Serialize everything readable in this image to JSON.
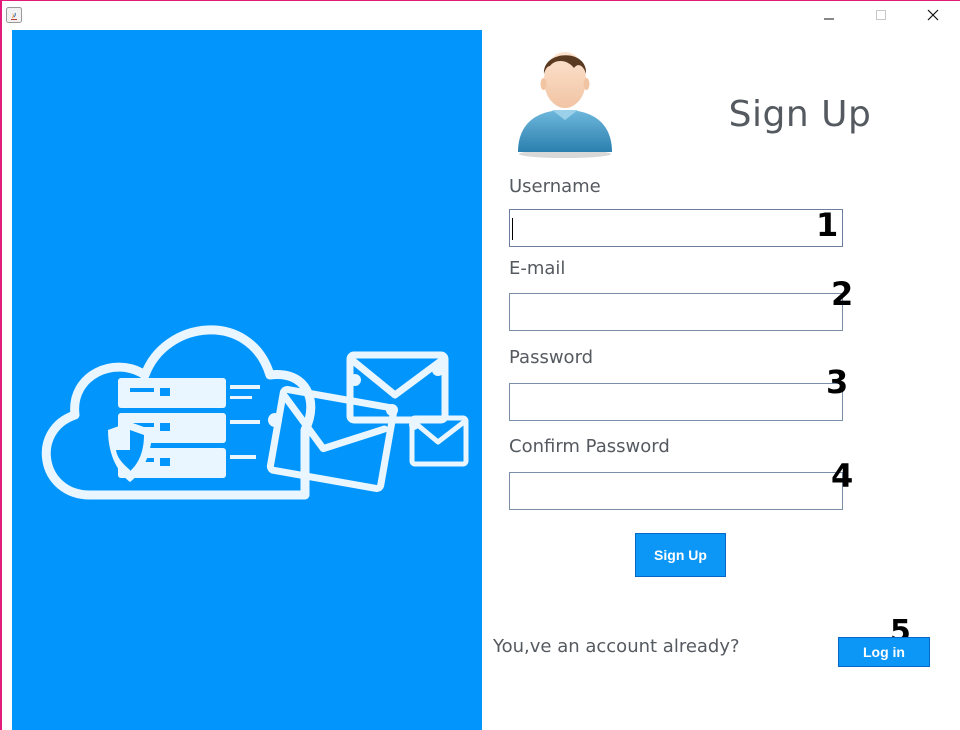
{
  "window": {
    "minimize_icon": "minimize-icon",
    "maximize_icon": "maximize-icon",
    "close_icon": "close-icon"
  },
  "colors": {
    "panel_blue": "#0296fd",
    "button_blue": "#0c97f6",
    "text_gray": "#555a60"
  },
  "form": {
    "title": "Sign Up",
    "fields": [
      {
        "label": "Username",
        "value": "",
        "annotation": "1"
      },
      {
        "label": "E-mail",
        "value": "",
        "annotation": "2"
      },
      {
        "label": "Password",
        "value": "",
        "annotation": "3"
      },
      {
        "label": "Confirm Password",
        "value": "",
        "annotation": "4"
      }
    ],
    "signup_label": "Sign Up"
  },
  "footer": {
    "account_text": "You,ve an account already?",
    "login_label": "Log in",
    "login_annotation": "5"
  }
}
